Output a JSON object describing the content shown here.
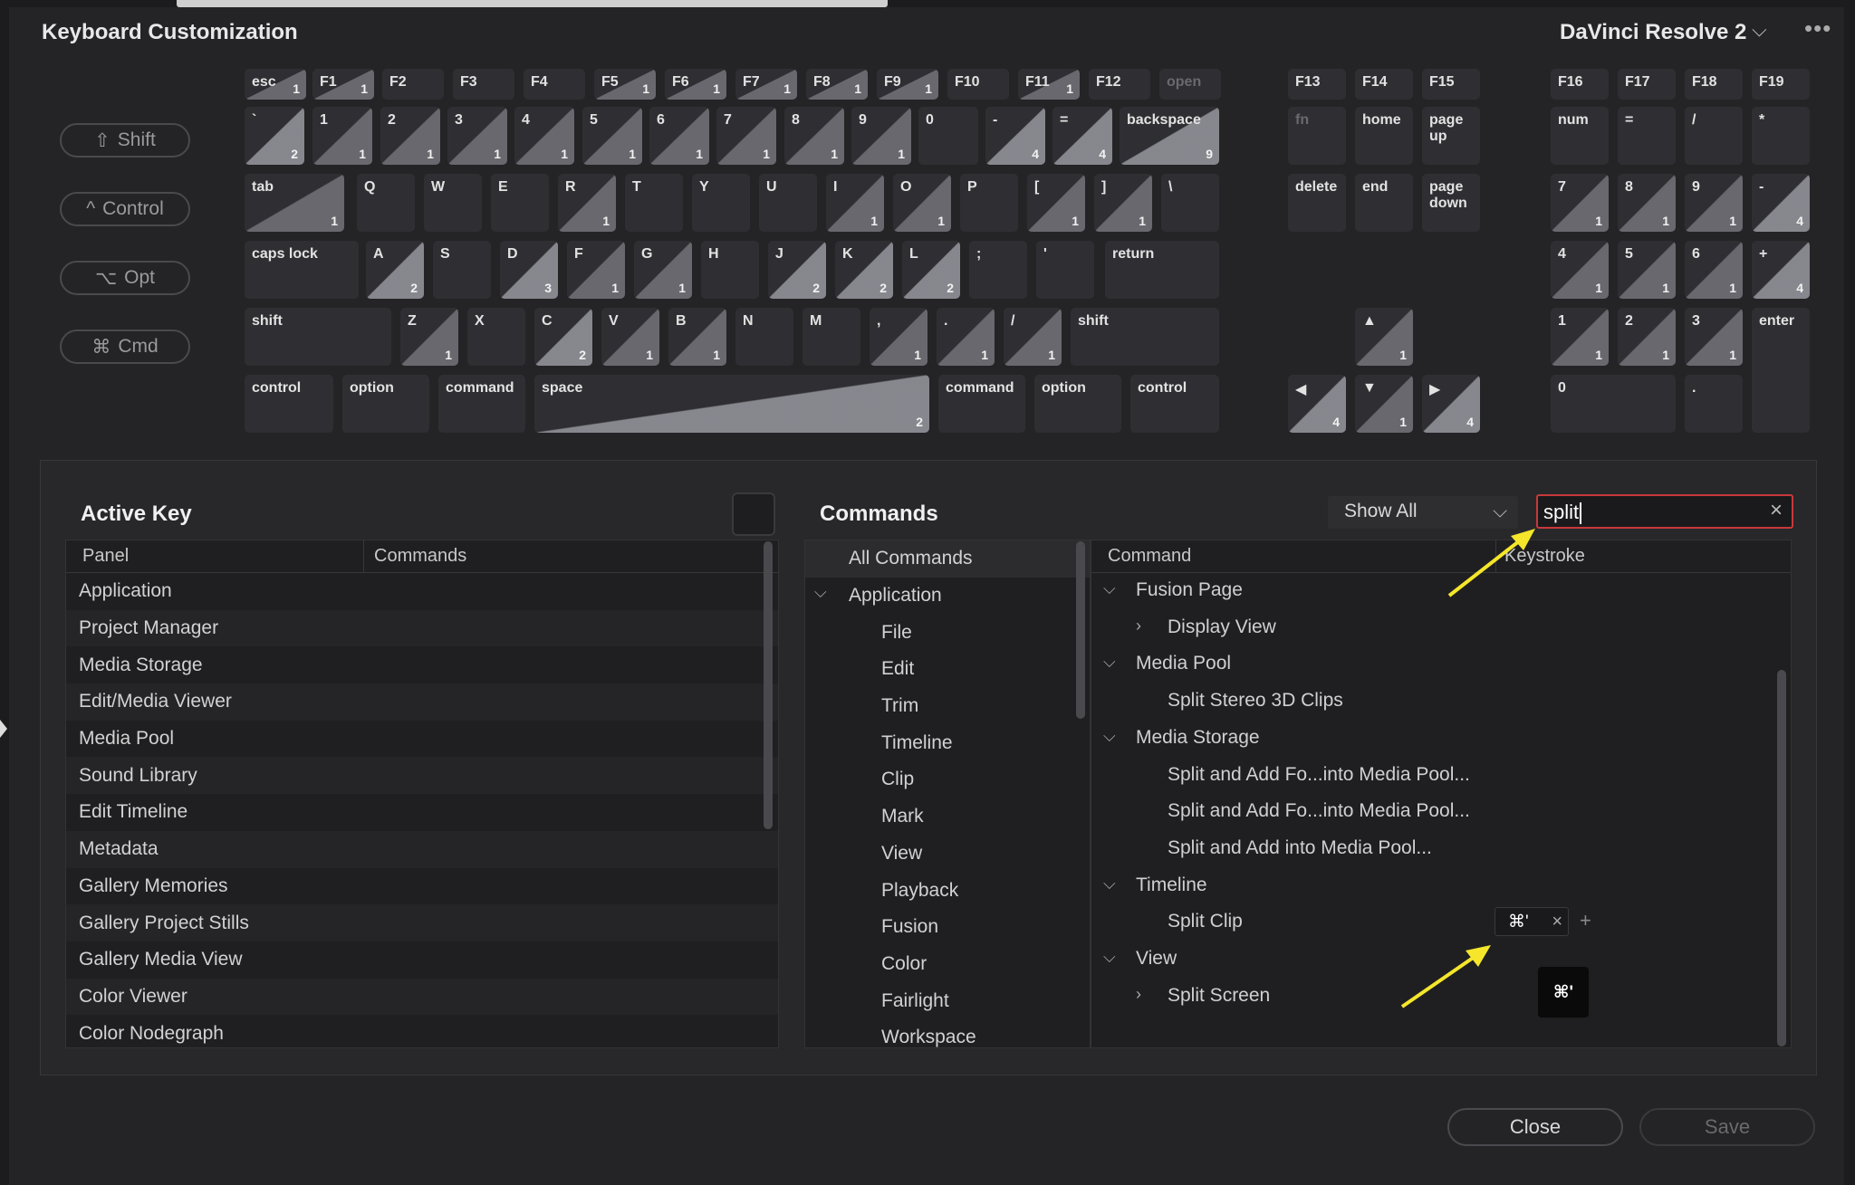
{
  "window": {
    "title": "Keyboard Customization",
    "preset": "DaVinci Resolve 2",
    "more": "•••"
  },
  "modifiers": [
    {
      "symbol": "⇧",
      "label": "Shift"
    },
    {
      "symbol": "^",
      "label": "Control"
    },
    {
      "symbol": "⌥",
      "label": "Opt"
    },
    {
      "symbol": "⌘",
      "label": "Cmd"
    }
  ],
  "keys": [
    {
      "l": "esc",
      "c": "1"
    },
    {
      "l": "F1",
      "c": "1"
    },
    {
      "l": "F2",
      "c": ""
    },
    {
      "l": "F3",
      "c": ""
    },
    {
      "l": "F4",
      "c": ""
    },
    {
      "l": "F5",
      "c": "1"
    },
    {
      "l": "F6",
      "c": "1"
    },
    {
      "l": "F7",
      "c": "1"
    },
    {
      "l": "F8",
      "c": "1"
    },
    {
      "l": "F9",
      "c": "1"
    },
    {
      "l": "F10",
      "c": ""
    },
    {
      "l": "F11",
      "c": "1"
    },
    {
      "l": "F12",
      "c": ""
    },
    {
      "l": "open",
      "c": ""
    },
    {
      "l": "`",
      "c": "2"
    },
    {
      "l": "1",
      "c": "1"
    },
    {
      "l": "2",
      "c": "1"
    },
    {
      "l": "3",
      "c": "1"
    },
    {
      "l": "4",
      "c": "1"
    },
    {
      "l": "5",
      "c": "1"
    },
    {
      "l": "6",
      "c": "1"
    },
    {
      "l": "7",
      "c": "1"
    },
    {
      "l": "8",
      "c": "1"
    },
    {
      "l": "9",
      "c": "1"
    },
    {
      "l": "0",
      "c": ""
    },
    {
      "l": "-",
      "c": "4"
    },
    {
      "l": "=",
      "c": "4"
    },
    {
      "l": "backspace",
      "c": "9"
    },
    {
      "l": "tab",
      "c": "1"
    },
    {
      "l": "Q",
      "c": ""
    },
    {
      "l": "W",
      "c": ""
    },
    {
      "l": "E",
      "c": ""
    },
    {
      "l": "R",
      "c": "1"
    },
    {
      "l": "T",
      "c": ""
    },
    {
      "l": "Y",
      "c": ""
    },
    {
      "l": "U",
      "c": ""
    },
    {
      "l": "I",
      "c": "1"
    },
    {
      "l": "O",
      "c": "1"
    },
    {
      "l": "P",
      "c": ""
    },
    {
      "l": "[",
      "c": "1"
    },
    {
      "l": "]",
      "c": "1"
    },
    {
      "l": "\\",
      "c": ""
    },
    {
      "l": "caps lock",
      "c": ""
    },
    {
      "l": "A",
      "c": "2"
    },
    {
      "l": "S",
      "c": ""
    },
    {
      "l": "D",
      "c": "3"
    },
    {
      "l": "F",
      "c": "1"
    },
    {
      "l": "G",
      "c": "1"
    },
    {
      "l": "H",
      "c": ""
    },
    {
      "l": "J",
      "c": "2"
    },
    {
      "l": "K",
      "c": "2"
    },
    {
      "l": "L",
      "c": "2"
    },
    {
      "l": ";",
      "c": ""
    },
    {
      "l": "'",
      "c": ""
    },
    {
      "l": "return",
      "c": ""
    },
    {
      "l": "shift",
      "c": ""
    },
    {
      "l": "Z",
      "c": "1"
    },
    {
      "l": "X",
      "c": ""
    },
    {
      "l": "C",
      "c": "2"
    },
    {
      "l": "V",
      "c": "1"
    },
    {
      "l": "B",
      "c": "1"
    },
    {
      "l": "N",
      "c": ""
    },
    {
      "l": "M",
      "c": ""
    },
    {
      "l": ",",
      "c": "1"
    },
    {
      "l": ".",
      "c": "1"
    },
    {
      "l": "/",
      "c": "1"
    },
    {
      "l": "shift",
      "c": ""
    },
    {
      "l": "control",
      "c": ""
    },
    {
      "l": "option",
      "c": ""
    },
    {
      "l": "command",
      "c": ""
    },
    {
      "l": "space",
      "c": "2"
    },
    {
      "l": "command",
      "c": ""
    },
    {
      "l": "option",
      "c": ""
    },
    {
      "l": "control",
      "c": ""
    },
    {
      "l": "F13",
      "c": ""
    },
    {
      "l": "F14",
      "c": ""
    },
    {
      "l": "F15",
      "c": ""
    },
    {
      "l": "fn",
      "c": ""
    },
    {
      "l": "home",
      "c": ""
    },
    {
      "l": "page up",
      "c": ""
    },
    {
      "l": "delete",
      "c": ""
    },
    {
      "l": "end",
      "c": ""
    },
    {
      "l": "page down",
      "c": ""
    },
    {
      "l": "▲",
      "c": "1"
    },
    {
      "l": "◀",
      "c": "4"
    },
    {
      "l": "▼",
      "c": "1"
    },
    {
      "l": "▶",
      "c": "4"
    },
    {
      "l": "F16",
      "c": ""
    },
    {
      "l": "F17",
      "c": ""
    },
    {
      "l": "F18",
      "c": ""
    },
    {
      "l": "F19",
      "c": ""
    },
    {
      "l": "num",
      "c": ""
    },
    {
      "l": "=",
      "c": ""
    },
    {
      "l": "/",
      "c": ""
    },
    {
      "l": "*",
      "c": ""
    },
    {
      "l": "7",
      "c": "1"
    },
    {
      "l": "8",
      "c": "1"
    },
    {
      "l": "9",
      "c": "1"
    },
    {
      "l": "-",
      "c": "4"
    },
    {
      "l": "4",
      "c": "1"
    },
    {
      "l": "5",
      "c": "1"
    },
    {
      "l": "6",
      "c": "1"
    },
    {
      "l": "+",
      "c": "4"
    },
    {
      "l": "1",
      "c": "1"
    },
    {
      "l": "2",
      "c": "1"
    },
    {
      "l": "3",
      "c": "1"
    },
    {
      "l": "enter",
      "c": ""
    },
    {
      "l": "0",
      "c": ""
    },
    {
      "l": ".",
      "c": ""
    }
  ],
  "active_key": {
    "title": "Active Key",
    "col_panel": "Panel",
    "col_commands": "Commands",
    "rows": [
      "Application",
      "Project Manager",
      "Media Storage",
      "Edit/Media Viewer",
      "Media Pool",
      "Sound Library",
      "Edit Timeline",
      "Metadata",
      "Gallery Memories",
      "Gallery Project Stills",
      "Gallery Media View",
      "Color Viewer",
      "Color Nodegraph"
    ]
  },
  "commands": {
    "title": "Commands",
    "filter": "Show All",
    "search_value": "split",
    "categories": [
      "All Commands",
      "Application",
      "File",
      "Edit",
      "Trim",
      "Timeline",
      "Clip",
      "Mark",
      "View",
      "Playback",
      "Fusion",
      "Color",
      "Fairlight",
      "Workspace"
    ],
    "col_command": "Command",
    "col_keystroke": "Keystroke",
    "results": [
      {
        "t": "Fusion Page",
        "lvl": 0,
        "chev": "⌵"
      },
      {
        "t": "Display View",
        "lvl": 1,
        "chev": "›"
      },
      {
        "t": "Media Pool",
        "lvl": 0,
        "chev": "⌵"
      },
      {
        "t": "Split Stereo 3D Clips",
        "lvl": 1,
        "chev": ""
      },
      {
        "t": "Media Storage",
        "lvl": 0,
        "chev": "⌵"
      },
      {
        "t": "Split and Add Fo...into Media Pool...",
        "lvl": 1,
        "chev": ""
      },
      {
        "t": "Split and Add Fo...into Media Pool...",
        "lvl": 1,
        "chev": ""
      },
      {
        "t": "Split and Add into Media Pool...",
        "lvl": 1,
        "chev": ""
      },
      {
        "t": "Timeline",
        "lvl": 0,
        "chev": "⌵"
      },
      {
        "t": "Split Clip",
        "lvl": 1,
        "chev": ""
      },
      {
        "t": "View",
        "lvl": 0,
        "chev": "⌵"
      },
      {
        "t": "Split Screen",
        "lvl": 1,
        "chev": "›"
      }
    ],
    "split_clip_shortcut": "⌘'",
    "tooltip": "⌘'"
  },
  "buttons": {
    "close": "Close",
    "save": "Save"
  },
  "colors": {
    "search_border": "#c7383b",
    "annotation_arrow": "#f5e62b"
  }
}
